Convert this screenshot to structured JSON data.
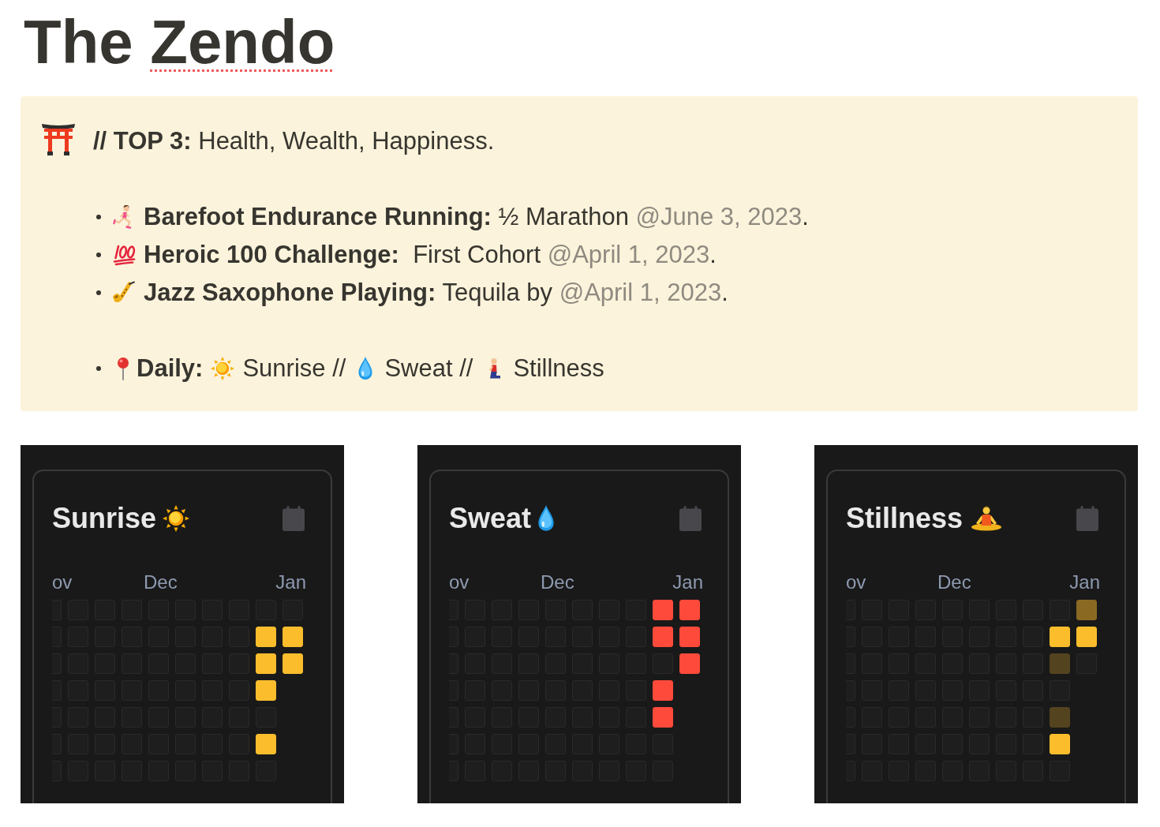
{
  "title": {
    "words": [
      {
        "text": "The",
        "misspelled": false
      },
      {
        "text": "Zendo",
        "misspelled": true
      }
    ]
  },
  "callout": {
    "heading": "**// TOP 3:** Health, Wealth, Happiness.",
    "goals": [
      {
        "text": "**Barefoot Endurance Running:** ½ Marathon",
        "date": "@June 3, 2023",
        "suffix": "."
      },
      {
        "text": "**Heroic 100 Challenge:**  First Cohort",
        "date": "@April 1, 2023",
        "suffix": "."
      },
      {
        "text": "**Jazz Saxophone Playing:** Tequila by",
        "date": "@April 1, 2023",
        "suffix": "."
      }
    ],
    "daily": {
      "label": "Daily:",
      "items": [
        {
          "text": "Sunrise",
          "trail": "//"
        },
        {
          "text": "Sweat",
          "trail": "//"
        },
        {
          "text": "Stillness"
        }
      ]
    }
  },
  "trackers": [
    {
      "title": "Sunrise",
      "color": "#fcbd2d",
      "months": [
        "ov",
        "Dec",
        "Jan"
      ],
      "weeks": [
        [
          {
            "done": false
          },
          {
            "done": false
          },
          {
            "done": false
          },
          {
            "done": false
          },
          {
            "done": false
          },
          {
            "done": false
          },
          {
            "done": false
          }
        ],
        [
          {
            "done": false
          },
          {
            "done": false
          },
          {
            "done": false
          },
          {
            "done": false
          },
          {
            "done": false
          },
          {
            "done": false
          },
          {
            "done": false
          }
        ],
        [
          {
            "done": false
          },
          {
            "done": false
          },
          {
            "done": false
          },
          {
            "done": false
          },
          {
            "done": false
          },
          {
            "done": false
          },
          {
            "done": false
          }
        ],
        [
          {
            "done": false
          },
          {
            "done": false
          },
          {
            "done": false
          },
          {
            "done": false
          },
          {
            "done": false
          },
          {
            "done": false
          },
          {
            "done": false
          }
        ],
        [
          {
            "done": false
          },
          {
            "done": false
          },
          {
            "done": false
          },
          {
            "done": false
          },
          {
            "done": false
          },
          {
            "done": false
          },
          {
            "done": false
          }
        ],
        [
          {
            "done": false
          },
          {
            "done": false
          },
          {
            "done": false
          },
          {
            "done": false
          },
          {
            "done": false
          },
          {
            "done": false
          },
          {
            "done": false
          }
        ],
        [
          {
            "done": false
          },
          {
            "done": false
          },
          {
            "done": false
          },
          {
            "done": false
          },
          {
            "done": false
          },
          {
            "done": false
          },
          {
            "done": false
          }
        ],
        [
          {
            "done": false
          },
          {
            "done": false
          },
          {
            "done": false
          },
          {
            "done": false
          },
          {
            "done": false
          },
          {
            "done": false
          },
          {
            "done": false
          }
        ],
        [
          {
            "done": false
          },
          {
            "done": true
          },
          {
            "done": true
          },
          {
            "done": true
          },
          {
            "done": false
          },
          {
            "done": true
          },
          {
            "done": false
          }
        ],
        [
          {
            "done": false
          },
          {
            "done": true
          },
          {
            "done": true
          }
        ]
      ]
    },
    {
      "title": "Sweat",
      "color": "#fe4a3b",
      "months": [
        "ov",
        "Dec",
        "Jan"
      ],
      "weeks": [
        [
          {
            "done": false
          },
          {
            "done": false
          },
          {
            "done": false
          },
          {
            "done": false
          },
          {
            "done": false
          },
          {
            "done": false
          },
          {
            "done": false
          }
        ],
        [
          {
            "done": false
          },
          {
            "done": false
          },
          {
            "done": false
          },
          {
            "done": false
          },
          {
            "done": false
          },
          {
            "done": false
          },
          {
            "done": false
          }
        ],
        [
          {
            "done": false
          },
          {
            "done": false
          },
          {
            "done": false
          },
          {
            "done": false
          },
          {
            "done": false
          },
          {
            "done": false
          },
          {
            "done": false
          }
        ],
        [
          {
            "done": false
          },
          {
            "done": false
          },
          {
            "done": false
          },
          {
            "done": false
          },
          {
            "done": false
          },
          {
            "done": false
          },
          {
            "done": false
          }
        ],
        [
          {
            "done": false
          },
          {
            "done": false
          },
          {
            "done": false
          },
          {
            "done": false
          },
          {
            "done": false
          },
          {
            "done": false
          },
          {
            "done": false
          }
        ],
        [
          {
            "done": false
          },
          {
            "done": false
          },
          {
            "done": false
          },
          {
            "done": false
          },
          {
            "done": false
          },
          {
            "done": false
          },
          {
            "done": false
          }
        ],
        [
          {
            "done": false
          },
          {
            "done": false
          },
          {
            "done": false
          },
          {
            "done": false
          },
          {
            "done": false
          },
          {
            "done": false
          },
          {
            "done": false
          }
        ],
        [
          {
            "done": false
          },
          {
            "done": false
          },
          {
            "done": false
          },
          {
            "done": false
          },
          {
            "done": false
          },
          {
            "done": false
          },
          {
            "done": false
          }
        ],
        [
          {
            "done": true
          },
          {
            "done": true
          },
          {
            "done": false
          },
          {
            "done": true
          },
          {
            "done": true
          },
          {
            "done": false
          },
          {
            "done": false
          }
        ],
        [
          {
            "done": true
          },
          {
            "done": true
          },
          {
            "done": true
          }
        ]
      ]
    },
    {
      "title": "Stillness",
      "color": "#fcbd2d",
      "months": [
        "ov",
        "Dec",
        "Jan"
      ],
      "weeks": [
        [
          {
            "done": false
          },
          {
            "done": false
          },
          {
            "done": false
          },
          {
            "done": false
          },
          {
            "done": false
          },
          {
            "done": false
          },
          {
            "done": false
          }
        ],
        [
          {
            "done": false
          },
          {
            "done": false
          },
          {
            "done": false
          },
          {
            "done": false
          },
          {
            "done": false
          },
          {
            "done": false
          },
          {
            "done": false
          }
        ],
        [
          {
            "done": false
          },
          {
            "done": false
          },
          {
            "done": false
          },
          {
            "done": false
          },
          {
            "done": false
          },
          {
            "done": false
          },
          {
            "done": false
          }
        ],
        [
          {
            "done": false
          },
          {
            "done": false
          },
          {
            "done": false
          },
          {
            "done": false
          },
          {
            "done": false
          },
          {
            "done": false
          },
          {
            "done": false
          }
        ],
        [
          {
            "done": false
          },
          {
            "done": false
          },
          {
            "done": false
          },
          {
            "done": false
          },
          {
            "done": false
          },
          {
            "done": false
          },
          {
            "done": false
          }
        ],
        [
          {
            "done": false
          },
          {
            "done": false
          },
          {
            "done": false
          },
          {
            "done": false
          },
          {
            "done": false
          },
          {
            "done": false
          },
          {
            "done": false
          }
        ],
        [
          {
            "done": false
          },
          {
            "done": false
          },
          {
            "done": false
          },
          {
            "done": false
          },
          {
            "done": false
          },
          {
            "done": false
          },
          {
            "done": false
          }
        ],
        [
          {
            "done": false
          },
          {
            "done": false
          },
          {
            "done": false
          },
          {
            "done": false
          },
          {
            "done": false
          },
          {
            "done": false
          },
          {
            "done": false
          }
        ],
        [
          {
            "done": false
          },
          {
            "done": true
          },
          {
            "done": true,
            "color": "#54431f"
          },
          {
            "done": false
          },
          {
            "done": true,
            "color": "#54431f"
          },
          {
            "done": true
          },
          {
            "done": false
          }
        ],
        [
          {
            "done": true,
            "color": "#8a6a22"
          },
          {
            "done": true
          },
          {
            "done": false
          }
        ]
      ]
    }
  ]
}
